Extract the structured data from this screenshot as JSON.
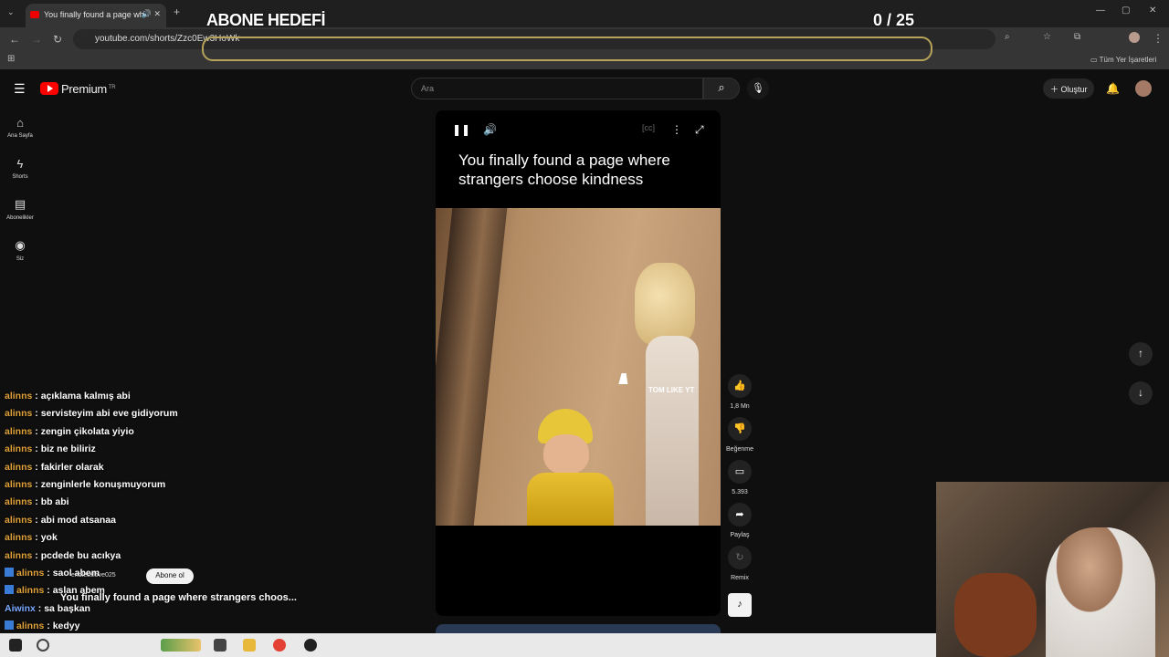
{
  "browser": {
    "tab_title": "You finally found a page wh",
    "url": "youtube.com/shorts/Zzc0Ew3HoWk",
    "bookmark_label": "Tüm Yer İşaretleri"
  },
  "overlay": {
    "goal_title": "ABONE HEDEFİ",
    "goal_count": "0  / 25"
  },
  "youtube": {
    "brand": "Premium",
    "region": "TR",
    "search_placeholder": "Ara",
    "create_label": "Oluştur",
    "sidebar": [
      {
        "label": "Ana Sayfa",
        "icon": "home-icon"
      },
      {
        "label": "Shorts",
        "icon": "shorts-icon"
      },
      {
        "label": "Abonelikler",
        "icon": "subscriptions-icon"
      },
      {
        "label": "Siz",
        "icon": "you-icon"
      }
    ],
    "video": {
      "caption": "You finally found a page where strangers choose kindness",
      "watermark": "TOM LIKE YT"
    },
    "actions": {
      "likes": "1,8 Mn",
      "dislike": "Beğenme",
      "comments": "5.393",
      "share": "Paylaş",
      "remix": "Remix"
    }
  },
  "chat": [
    {
      "user": "alinns",
      "msg": "açıklama kalmış abi"
    },
    {
      "user": "alinns",
      "msg": "servisteyim abi eve gidiyorum"
    },
    {
      "user": "alinns",
      "msg": "zengin çikolata yiyio"
    },
    {
      "user": "alinns",
      "msg": "biz ne biliriz"
    },
    {
      "user": "alinns",
      "msg": "fakirler olarak"
    },
    {
      "user": "alinns",
      "msg": "zenginlerle konuşmuyorum"
    },
    {
      "user": "alinns",
      "msg": "bb abi"
    },
    {
      "user": "alinns",
      "msg": "abi mod atsanaa"
    },
    {
      "user": "alinns",
      "msg": "yok"
    },
    {
      "user": "alinns",
      "msg": "pcdede bu acıkya"
    },
    {
      "user": "alinns",
      "msg": "saol abem"
    },
    {
      "user": "alinns",
      "msg": "aslan abem"
    },
    {
      "user": "Aiwinx",
      "msg": "sa başkan"
    },
    {
      "user": "alinns",
      "msg": "kedyy"
    }
  ],
  "subscribe": {
    "channel": "endlesslove025",
    "button": "Abone ol",
    "now_playing": "You finally found a page where strangers choos..."
  }
}
